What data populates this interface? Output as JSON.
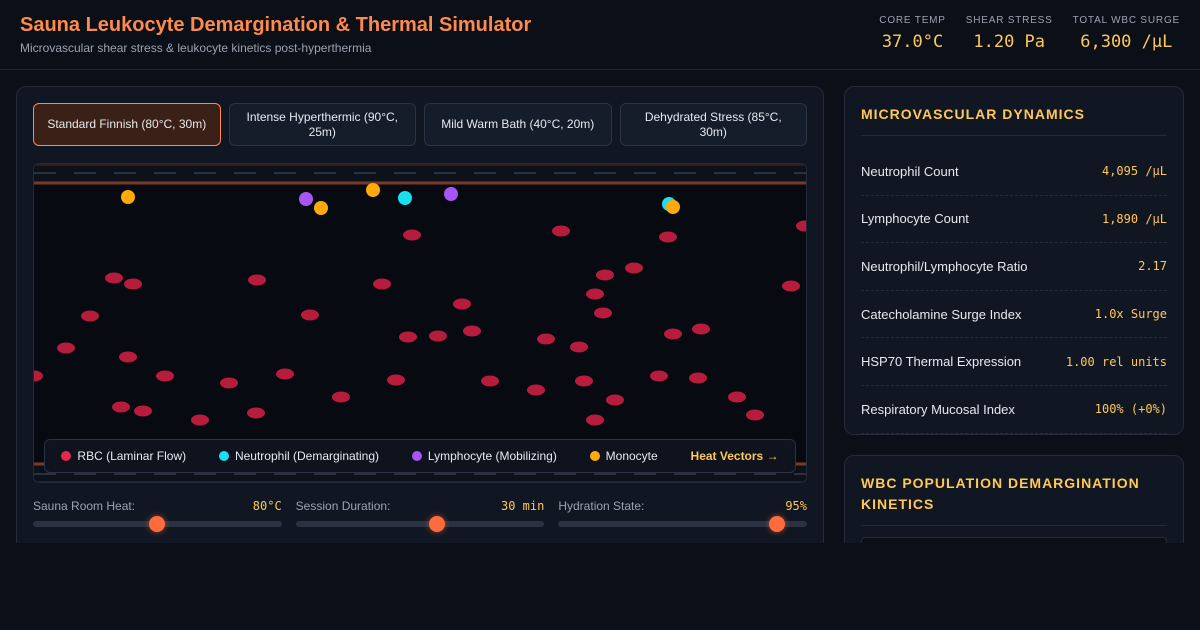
{
  "header": {
    "title": "Sauna Leukocyte Demargination & Thermal Simulator",
    "subtitle": "Microvascular shear stress & leukocyte kinetics post-hyperthermia",
    "stats": [
      {
        "label": "CORE TEMP",
        "value": "37.0°C"
      },
      {
        "label": "SHEAR STRESS",
        "value": "1.20 Pa"
      },
      {
        "label": "TOTAL WBC SURGE",
        "value": "6,300 /µL"
      }
    ]
  },
  "presets": [
    {
      "label": "Standard Finnish (80°C, 30m)",
      "active": true
    },
    {
      "label": "Intense Hyperthermic (90°C, 25m)",
      "active": false
    },
    {
      "label": "Mild Warm Bath (40°C, 20m)",
      "active": false
    },
    {
      "label": "Dehydrated Stress (85°C, 30m)",
      "active": false
    }
  ],
  "legend": {
    "rbc": "RBC (Laminar Flow)",
    "neutrophil": "Neutrophil (Demarginating)",
    "lymphocyte": "Lymphocyte (Mobilizing)",
    "monocyte": "Monocyte",
    "heat_vectors": "Heat Vectors →"
  },
  "colors": {
    "rbc": "#b71c3c",
    "neutrophil": "#18e0f0",
    "lymphocyte": "#a855f7",
    "monocyte": "#ffa90a",
    "accent": "#ff8a4c",
    "value": "#ffc857"
  },
  "sliders": [
    {
      "label": "Sauna Room Heat:",
      "value": "80°C",
      "level": 0.5
    },
    {
      "label": "Session Duration:",
      "value": "30 min",
      "level": 0.57
    },
    {
      "label": "Hydration State:",
      "value": "95%",
      "level": 0.88
    }
  ],
  "panel_dynamics": {
    "title": "MICROVASCULAR DYNAMICS",
    "metrics": [
      {
        "label": "Neutrophil Count",
        "value": "4,095 /µL"
      },
      {
        "label": "Lymphocyte Count",
        "value": "1,890 /µL"
      },
      {
        "label": "Neutrophil/Lymphocyte Ratio",
        "value": "2.17"
      },
      {
        "label": "Catecholamine Surge Index",
        "value": "1.0x Surge"
      },
      {
        "label": "HSP70 Thermal Expression",
        "value": "1.00 rel units"
      },
      {
        "label": "Respiratory Mucosal Index",
        "value": "100% (+0%)"
      }
    ]
  },
  "panel_kinetics": {
    "title": "WBC POPULATION DEMARGINATION KINETICS"
  }
}
